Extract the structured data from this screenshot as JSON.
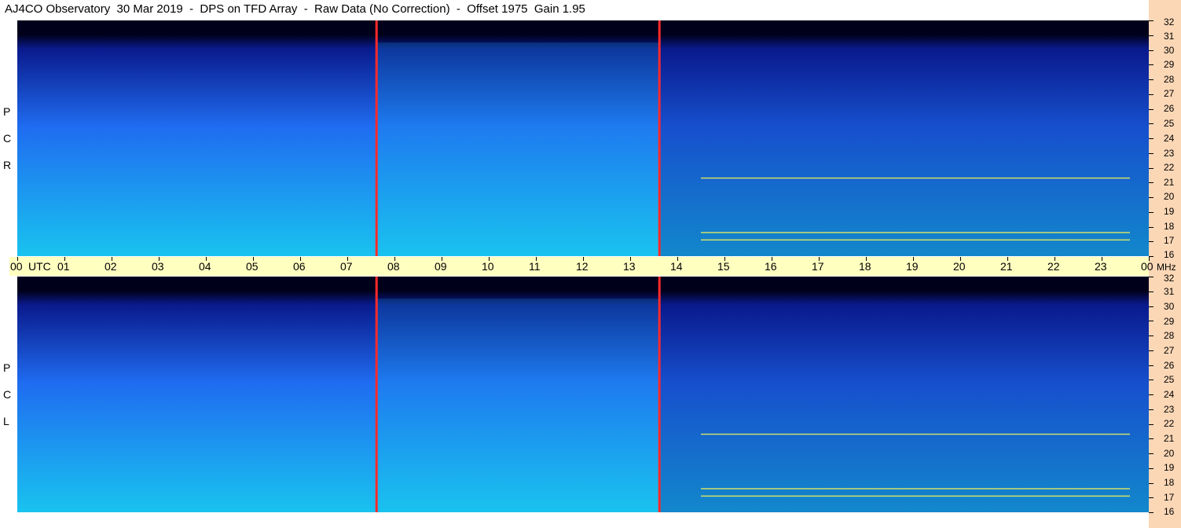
{
  "title": "AJ4CO Observatory  30 Mar 2019  -  DPS on TFD Array  -  Raw Data (No Correction)  -  Offset 1975  Gain 1.95",
  "chart_data": {
    "type": "heatmap",
    "title": "AJ4CO Observatory  30 Mar 2019  -  DPS on TFD Array  -  Raw Data (No Correction)  -  Offset 1975  Gain 1.95",
    "x_axis": {
      "unit_label": "UTC",
      "tick_labels": [
        "00",
        "01",
        "02",
        "03",
        "04",
        "05",
        "06",
        "07",
        "08",
        "09",
        "10",
        "11",
        "12",
        "13",
        "14",
        "15",
        "16",
        "17",
        "18",
        "19",
        "20",
        "21",
        "22",
        "23",
        "00"
      ],
      "range": [
        0,
        24
      ]
    },
    "y_axis": {
      "unit_label": "MHz",
      "tick_labels": [
        "32",
        "31",
        "30",
        "29",
        "28",
        "27",
        "26",
        "25",
        "24",
        "23",
        "22",
        "21",
        "20",
        "19",
        "18",
        "17",
        "16"
      ],
      "range": [
        16,
        32
      ]
    },
    "panels": [
      {
        "name": "RCP",
        "letters": [
          "P",
          "C",
          "R"
        ]
      },
      {
        "name": "LCP",
        "letters": [
          "P",
          "C",
          "L"
        ]
      }
    ],
    "markers_utc": [
      7.62,
      13.62
    ],
    "bright_bands_mhz": [
      21.3,
      17.1,
      17.6
    ],
    "colors": {
      "background_dark": "#00001a",
      "low": "#0a1a8c",
      "mid": "#1f6cf0",
      "high": "#19c3ef",
      "band": "#f2f25a",
      "marker": "#ff2a2a",
      "time_bar": "#ffffc0",
      "right_stripe": "#fbd7b6"
    }
  }
}
